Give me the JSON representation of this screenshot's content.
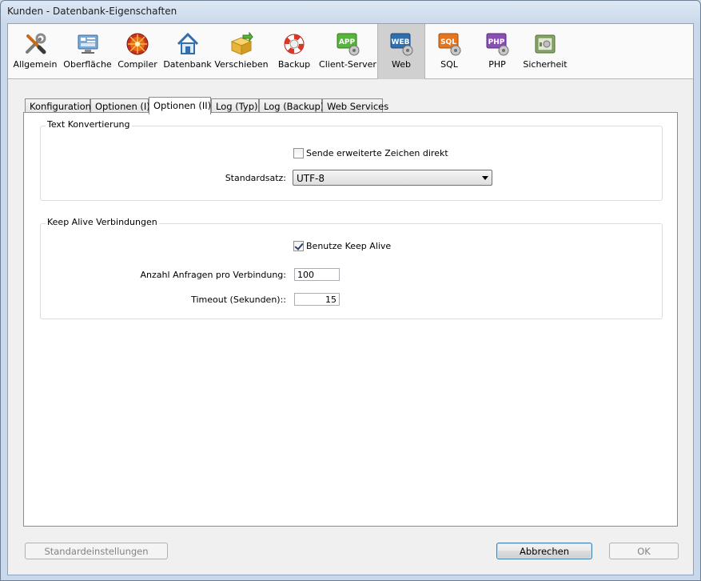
{
  "window": {
    "title": "Kunden - Datenbank-Eigenschaften"
  },
  "toolbar": {
    "items": [
      {
        "label": "Allgemein",
        "icon": "tools-icon"
      },
      {
        "label": "Oberfläche",
        "icon": "monitor-icon"
      },
      {
        "label": "Compiler",
        "icon": "compiler-disc-icon"
      },
      {
        "label": "Datenbank",
        "icon": "house-icon"
      },
      {
        "label": "Verschieben",
        "icon": "box-arrow-icon"
      },
      {
        "label": "Backup",
        "icon": "lifebuoy-icon"
      },
      {
        "label": "Client-Server",
        "icon": "app-server-icon"
      },
      {
        "label": "Web",
        "icon": "web-server-icon",
        "active": true
      },
      {
        "label": "SQL",
        "icon": "sql-server-icon"
      },
      {
        "label": "PHP",
        "icon": "php-server-icon"
      },
      {
        "label": "Sicherheit",
        "icon": "safe-icon"
      }
    ]
  },
  "tabs": [
    {
      "label": "Konfiguration"
    },
    {
      "label": "Optionen (I)"
    },
    {
      "label": "Optionen (II)",
      "active": true
    },
    {
      "label": "Log (Typ)"
    },
    {
      "label": "Log (Backup)"
    },
    {
      "label": "Web Services"
    }
  ],
  "text_conversion": {
    "title": "Text Konvertierung",
    "send_extended_label": "Sende erweiterte Zeichen direkt",
    "send_extended_checked": false,
    "charset_label": "Standardsatz:",
    "charset_value": "UTF-8"
  },
  "keep_alive": {
    "title": "Keep Alive Verbindungen",
    "use_keep_alive_label": "Benutze Keep Alive",
    "use_keep_alive_checked": true,
    "requests_label": "Anzahl Anfragen pro Verbindung:",
    "requests_value": "100",
    "timeout_label": "Timeout (Sekunden)::",
    "timeout_value": "15"
  },
  "buttons": {
    "defaults": "Standardeinstellungen",
    "cancel": "Abbrechen",
    "ok": "OK"
  },
  "colors": {
    "title_bar": "#cfdbe9",
    "active_toolbar": "#d0d0d0",
    "panel_bg": "#ffffff"
  }
}
